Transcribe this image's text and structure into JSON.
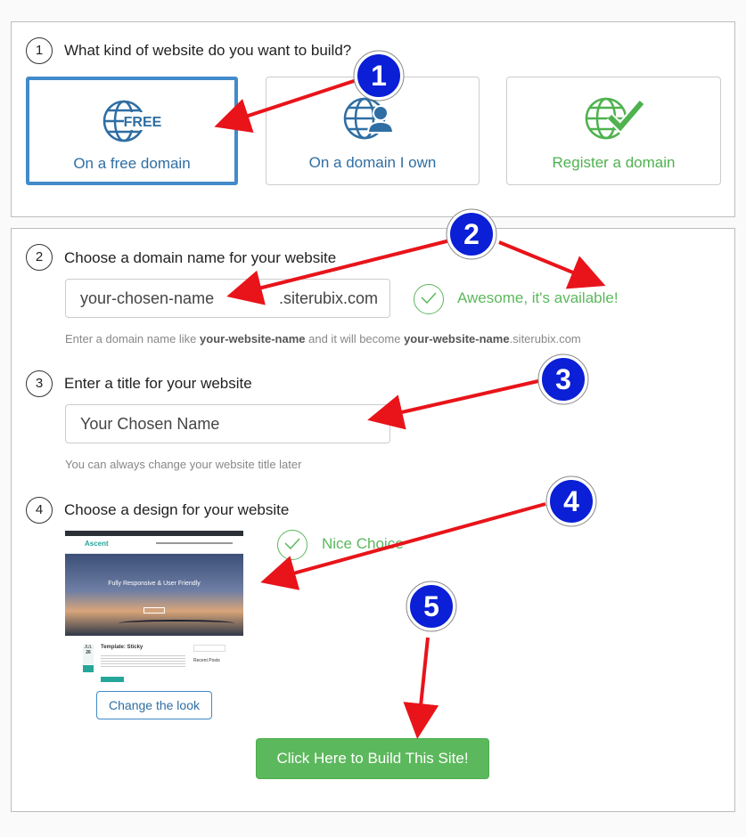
{
  "step1": {
    "number": "1",
    "question": "What kind of website do you want to build?",
    "options": [
      {
        "label": "On a free domain",
        "icon_text": "FREE",
        "icon": "globe-free-icon",
        "selected": true
      },
      {
        "label": "On a domain I own",
        "icon": "globe-user-icon",
        "selected": false
      },
      {
        "label": "Register a domain",
        "icon": "globe-check-icon",
        "selected": false
      }
    ]
  },
  "step2": {
    "number": "2",
    "label": "Choose a domain name for your website",
    "input_value": "your-chosen-name",
    "suffix": ".siterubix.com",
    "status": "Awesome, it's available!",
    "help_prefix": "Enter a domain name like ",
    "help_bold1": "your-website-name",
    "help_middle": " and it will become ",
    "help_bold2": "your-website-name",
    "help_suffix": ".siterubix.com"
  },
  "step3": {
    "number": "3",
    "label": "Enter a title for your website",
    "input_value": "Your Chosen Name",
    "help": "You can always change your website title later"
  },
  "step4": {
    "number": "4",
    "label": "Choose a design for your website",
    "status": "Nice Choice",
    "preview": {
      "logo": "Ascent",
      "hero_title": "Fully Responsive & User Friendly",
      "post_title": "Template: Sticky",
      "month": "JUL",
      "day": "26",
      "sidebar_heading": "Recent Posts"
    },
    "change_look_label": "Change the look"
  },
  "build_button": "Click Here to Build This Site!",
  "badges": [
    "1",
    "2",
    "3",
    "4",
    "5"
  ],
  "colors": {
    "accent": "#428bca",
    "green": "#5cb85c",
    "arrow": "#e8141a",
    "badge": "#0a1fd6"
  }
}
